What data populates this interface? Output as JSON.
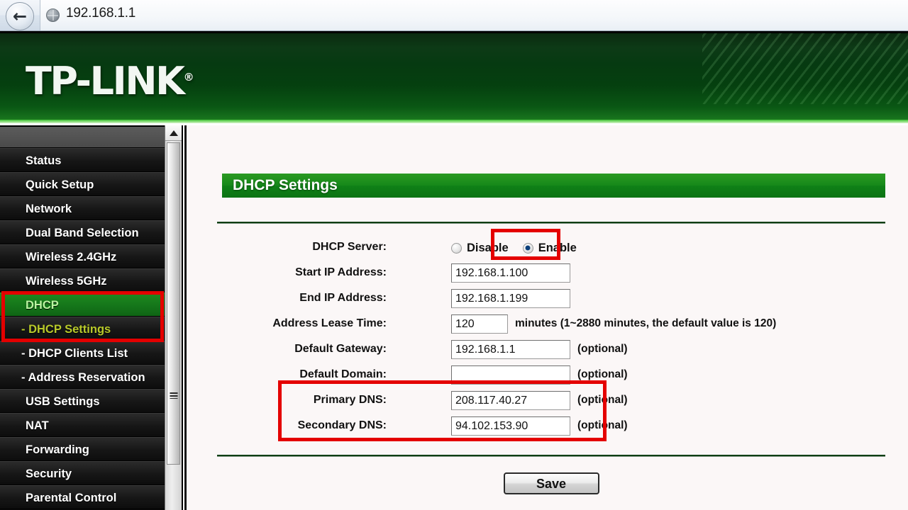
{
  "browser": {
    "back_icon": "back-arrow-icon",
    "favicon": "globe-icon",
    "url": "192.168.1.1"
  },
  "header": {
    "brand": "TP-LINK",
    "trademark": "®"
  },
  "sidebar": {
    "items": [
      {
        "label": "Status",
        "sub": false,
        "state": "normal"
      },
      {
        "label": "Quick Setup",
        "sub": false,
        "state": "normal"
      },
      {
        "label": "Network",
        "sub": false,
        "state": "normal"
      },
      {
        "label": "Dual Band Selection",
        "sub": false,
        "state": "normal"
      },
      {
        "label": "Wireless 2.4GHz",
        "sub": false,
        "state": "normal"
      },
      {
        "label": "Wireless 5GHz",
        "sub": false,
        "state": "normal"
      },
      {
        "label": "DHCP",
        "sub": false,
        "state": "active"
      },
      {
        "label": "- DHCP Settings",
        "sub": true,
        "state": "active-sub"
      },
      {
        "label": "- DHCP Clients List",
        "sub": true,
        "state": "normal"
      },
      {
        "label": "- Address Reservation",
        "sub": true,
        "state": "normal"
      },
      {
        "label": "USB Settings",
        "sub": false,
        "state": "normal"
      },
      {
        "label": "NAT",
        "sub": false,
        "state": "normal"
      },
      {
        "label": "Forwarding",
        "sub": false,
        "state": "normal"
      },
      {
        "label": "Security",
        "sub": false,
        "state": "normal"
      },
      {
        "label": "Parental Control",
        "sub": false,
        "state": "normal"
      }
    ]
  },
  "main": {
    "page_title": "DHCP Settings",
    "fields": {
      "dhcp_server": {
        "label": "DHCP Server:",
        "options": [
          {
            "label": "Disable",
            "selected": false
          },
          {
            "label": "Enable",
            "selected": true
          }
        ]
      },
      "start_ip": {
        "label": "Start IP Address:",
        "value": "192.168.1.100"
      },
      "end_ip": {
        "label": "End IP Address:",
        "value": "192.168.1.199"
      },
      "lease_time": {
        "label": "Address Lease Time:",
        "value": "120",
        "hint": "minutes (1~2880 minutes, the default value is 120)"
      },
      "default_gateway": {
        "label": "Default Gateway:",
        "value": "192.168.1.1",
        "hint": "(optional)"
      },
      "default_domain": {
        "label": "Default Domain:",
        "value": "",
        "hint": "(optional)"
      },
      "primary_dns": {
        "label": "Primary DNS:",
        "value": "208.117.40.27",
        "hint": "(optional)"
      },
      "secondary_dns": {
        "label": "Secondary DNS:",
        "value": "94.102.153.90",
        "hint": "(optional)"
      }
    },
    "save_label": "Save"
  },
  "colors": {
    "brand_green": "#0f8017",
    "annotation_red": "#e40000",
    "sidebar_active": "#15761a",
    "radio_dot": "#0b3f7a"
  }
}
